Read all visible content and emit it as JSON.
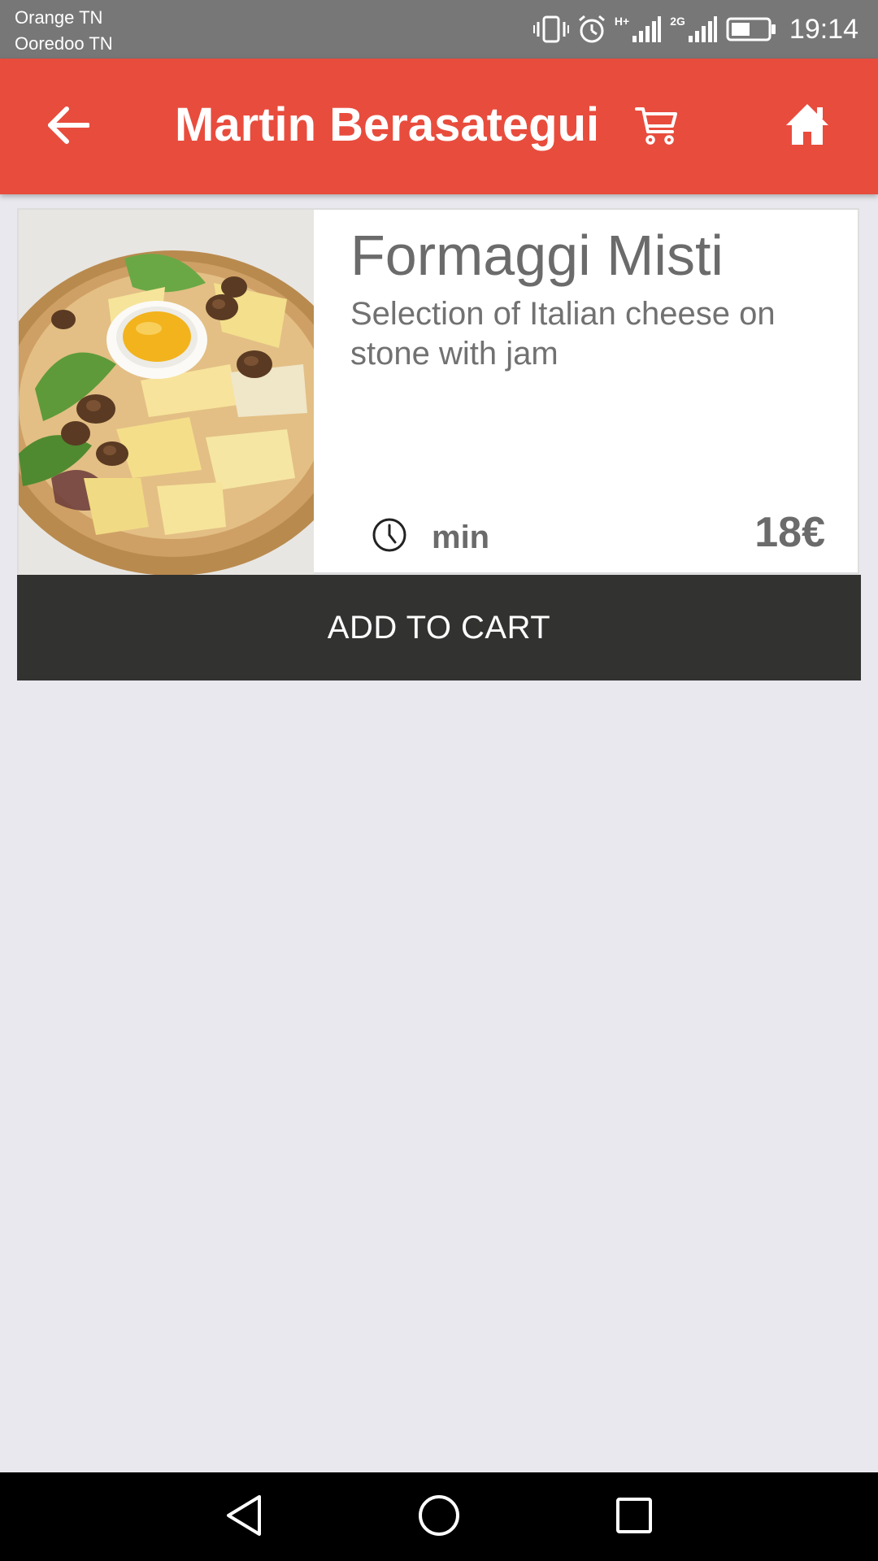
{
  "status_bar": {
    "carrier_1": "Orange TN",
    "carrier_2": "Ooredoo TN",
    "network_1_label": "H+",
    "network_2_label": "2G",
    "time": "19:14",
    "icons": [
      "vibrate-icon",
      "alarm-icon",
      "signal-icon",
      "signal-icon",
      "battery-icon"
    ]
  },
  "app_bar": {
    "title": "Martin Berasategui",
    "color": "#e84c3d",
    "icons": [
      "back-arrow-icon",
      "cart-icon",
      "home-icon"
    ]
  },
  "product": {
    "name": "Formaggi Misti",
    "description": "Selection of Italian cheese on stone with jam",
    "prep_time_unit": "min",
    "price": "18€",
    "image": "cheese-platter-photo"
  },
  "actions": {
    "add_to_cart_label": "ADD TO CART",
    "button_color": "#323230"
  },
  "nav_bar": {
    "icons": [
      "back-triangle-icon",
      "home-circle-icon",
      "recents-square-icon"
    ]
  }
}
